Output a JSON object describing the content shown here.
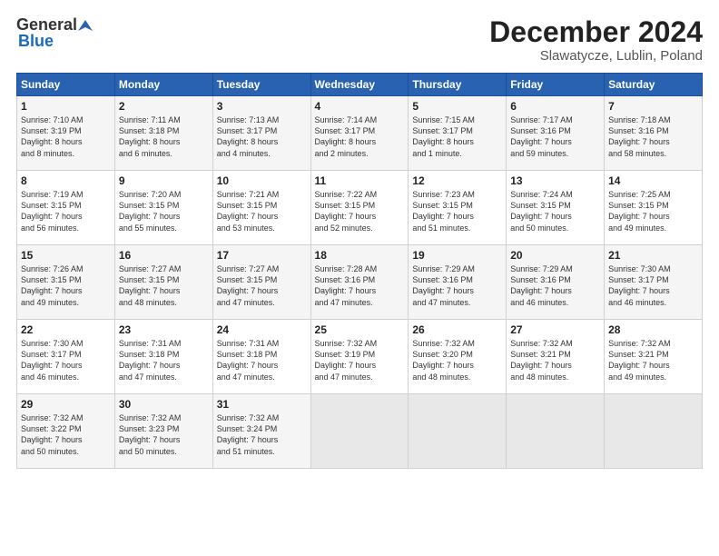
{
  "header": {
    "logo_general": "General",
    "logo_blue": "Blue",
    "month_title": "December 2024",
    "location": "Slawatycze, Lublin, Poland"
  },
  "columns": [
    "Sunday",
    "Monday",
    "Tuesday",
    "Wednesday",
    "Thursday",
    "Friday",
    "Saturday"
  ],
  "weeks": [
    [
      {
        "day": "1",
        "info": "Sunrise: 7:10 AM\nSunset: 3:19 PM\nDaylight: 8 hours\nand 8 minutes."
      },
      {
        "day": "2",
        "info": "Sunrise: 7:11 AM\nSunset: 3:18 PM\nDaylight: 8 hours\nand 6 minutes."
      },
      {
        "day": "3",
        "info": "Sunrise: 7:13 AM\nSunset: 3:17 PM\nDaylight: 8 hours\nand 4 minutes."
      },
      {
        "day": "4",
        "info": "Sunrise: 7:14 AM\nSunset: 3:17 PM\nDaylight: 8 hours\nand 2 minutes."
      },
      {
        "day": "5",
        "info": "Sunrise: 7:15 AM\nSunset: 3:17 PM\nDaylight: 8 hours\nand 1 minute."
      },
      {
        "day": "6",
        "info": "Sunrise: 7:17 AM\nSunset: 3:16 PM\nDaylight: 7 hours\nand 59 minutes."
      },
      {
        "day": "7",
        "info": "Sunrise: 7:18 AM\nSunset: 3:16 PM\nDaylight: 7 hours\nand 58 minutes."
      }
    ],
    [
      {
        "day": "8",
        "info": "Sunrise: 7:19 AM\nSunset: 3:15 PM\nDaylight: 7 hours\nand 56 minutes."
      },
      {
        "day": "9",
        "info": "Sunrise: 7:20 AM\nSunset: 3:15 PM\nDaylight: 7 hours\nand 55 minutes."
      },
      {
        "day": "10",
        "info": "Sunrise: 7:21 AM\nSunset: 3:15 PM\nDaylight: 7 hours\nand 53 minutes."
      },
      {
        "day": "11",
        "info": "Sunrise: 7:22 AM\nSunset: 3:15 PM\nDaylight: 7 hours\nand 52 minutes."
      },
      {
        "day": "12",
        "info": "Sunrise: 7:23 AM\nSunset: 3:15 PM\nDaylight: 7 hours\nand 51 minutes."
      },
      {
        "day": "13",
        "info": "Sunrise: 7:24 AM\nSunset: 3:15 PM\nDaylight: 7 hours\nand 50 minutes."
      },
      {
        "day": "14",
        "info": "Sunrise: 7:25 AM\nSunset: 3:15 PM\nDaylight: 7 hours\nand 49 minutes."
      }
    ],
    [
      {
        "day": "15",
        "info": "Sunrise: 7:26 AM\nSunset: 3:15 PM\nDaylight: 7 hours\nand 49 minutes."
      },
      {
        "day": "16",
        "info": "Sunrise: 7:27 AM\nSunset: 3:15 PM\nDaylight: 7 hours\nand 48 minutes."
      },
      {
        "day": "17",
        "info": "Sunrise: 7:27 AM\nSunset: 3:15 PM\nDaylight: 7 hours\nand 47 minutes."
      },
      {
        "day": "18",
        "info": "Sunrise: 7:28 AM\nSunset: 3:16 PM\nDaylight: 7 hours\nand 47 minutes."
      },
      {
        "day": "19",
        "info": "Sunrise: 7:29 AM\nSunset: 3:16 PM\nDaylight: 7 hours\nand 47 minutes."
      },
      {
        "day": "20",
        "info": "Sunrise: 7:29 AM\nSunset: 3:16 PM\nDaylight: 7 hours\nand 46 minutes."
      },
      {
        "day": "21",
        "info": "Sunrise: 7:30 AM\nSunset: 3:17 PM\nDaylight: 7 hours\nand 46 minutes."
      }
    ],
    [
      {
        "day": "22",
        "info": "Sunrise: 7:30 AM\nSunset: 3:17 PM\nDaylight: 7 hours\nand 46 minutes."
      },
      {
        "day": "23",
        "info": "Sunrise: 7:31 AM\nSunset: 3:18 PM\nDaylight: 7 hours\nand 47 minutes."
      },
      {
        "day": "24",
        "info": "Sunrise: 7:31 AM\nSunset: 3:18 PM\nDaylight: 7 hours\nand 47 minutes."
      },
      {
        "day": "25",
        "info": "Sunrise: 7:32 AM\nSunset: 3:19 PM\nDaylight: 7 hours\nand 47 minutes."
      },
      {
        "day": "26",
        "info": "Sunrise: 7:32 AM\nSunset: 3:20 PM\nDaylight: 7 hours\nand 48 minutes."
      },
      {
        "day": "27",
        "info": "Sunrise: 7:32 AM\nSunset: 3:21 PM\nDaylight: 7 hours\nand 48 minutes."
      },
      {
        "day": "28",
        "info": "Sunrise: 7:32 AM\nSunset: 3:21 PM\nDaylight: 7 hours\nand 49 minutes."
      }
    ],
    [
      {
        "day": "29",
        "info": "Sunrise: 7:32 AM\nSunset: 3:22 PM\nDaylight: 7 hours\nand 50 minutes."
      },
      {
        "day": "30",
        "info": "Sunrise: 7:32 AM\nSunset: 3:23 PM\nDaylight: 7 hours\nand 50 minutes."
      },
      {
        "day": "31",
        "info": "Sunrise: 7:32 AM\nSunset: 3:24 PM\nDaylight: 7 hours\nand 51 minutes."
      },
      {
        "day": "",
        "info": ""
      },
      {
        "day": "",
        "info": ""
      },
      {
        "day": "",
        "info": ""
      },
      {
        "day": "",
        "info": ""
      }
    ]
  ]
}
